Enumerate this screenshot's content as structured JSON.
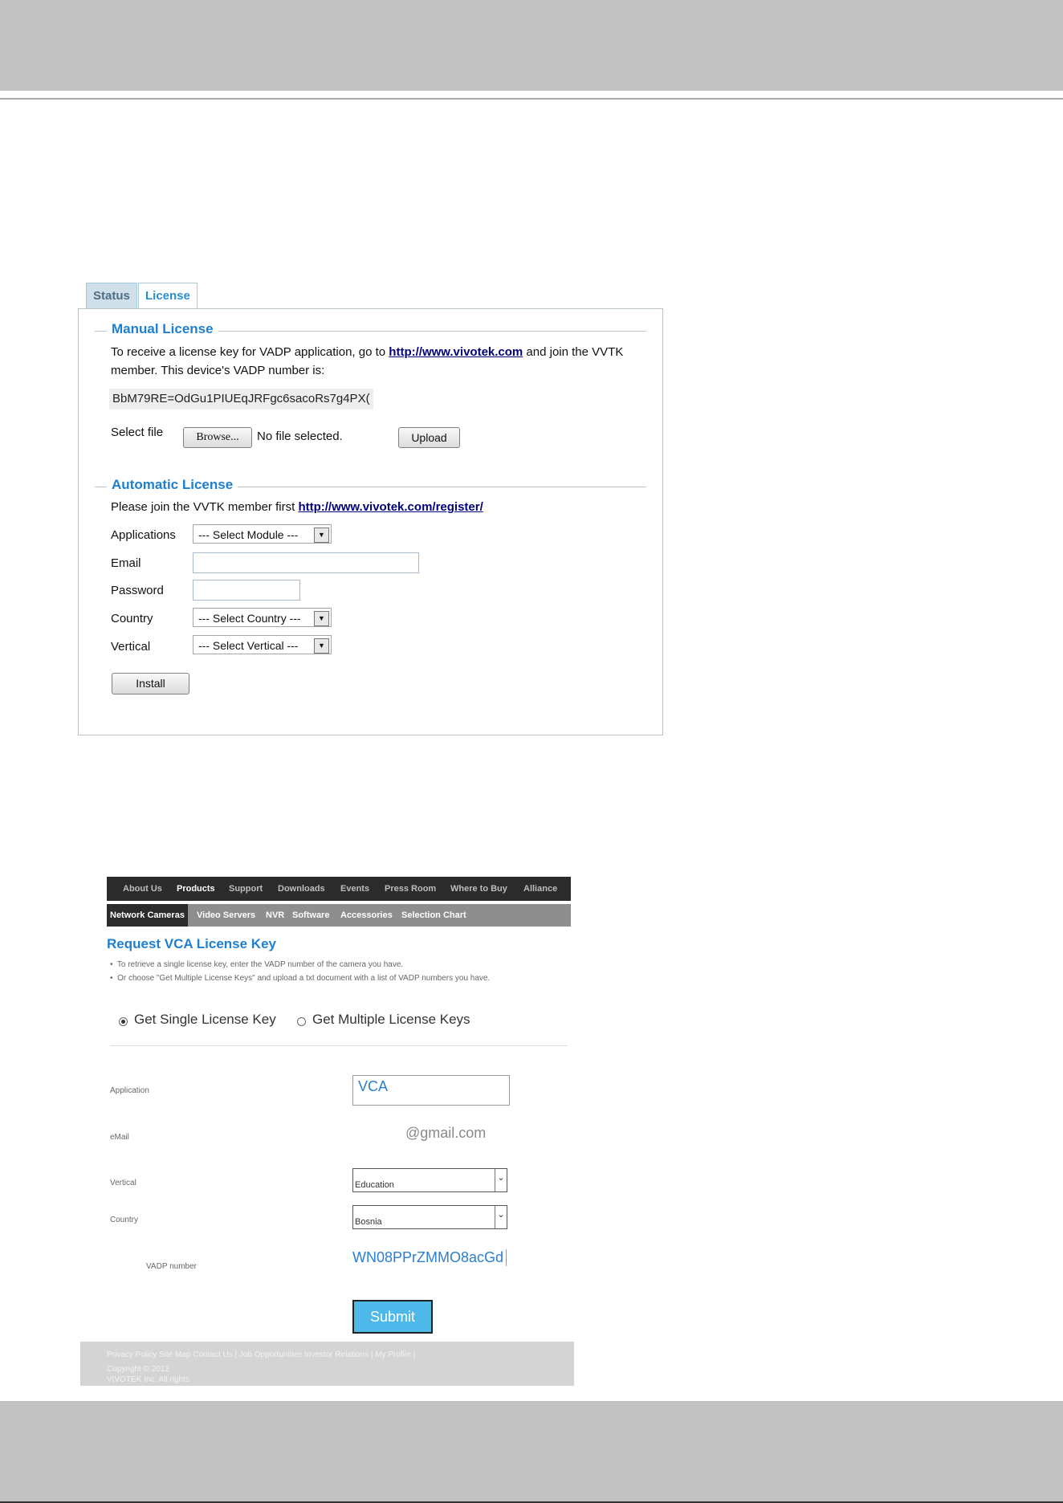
{
  "shot1": {
    "tabs": [
      "Status",
      "License"
    ],
    "manual": {
      "title": "Manual License",
      "line1_pre": "To receive a license key for VADP application, go to ",
      "line1_link": "http://www.vivotek.com",
      "line1_post": " and join the VVTK",
      "line2": "member. This device's VADP number is:",
      "vadp_number": "BbM79RE=OdGu1PIUEqJRFgc6sacoRs7g4PX(",
      "select_file_label": "Select file",
      "browse_label": "Browse...",
      "no_file_text": "No file selected.",
      "upload_label": "Upload"
    },
    "automatic": {
      "title": "Automatic License",
      "join_pre": "Please join the VVTK member first ",
      "join_link": "http://www.vivotek.com/register/",
      "applications_label": "Applications",
      "applications_value": "--- Select Module ---",
      "email_label": "Email",
      "password_label": "Password",
      "country_label": "Country",
      "country_value": "--- Select Country ---",
      "vertical_label": "Vertical",
      "vertical_value": "--- Select Vertical ---",
      "install_label": "Install"
    }
  },
  "shot2": {
    "nav_main": [
      "About Us",
      "Products",
      "Support",
      "Downloads",
      "Events",
      "Press Room",
      "Where to Buy",
      "Alliance"
    ],
    "nav_sub": [
      "Network Cameras",
      "Video Servers",
      "NVR",
      "Software",
      "Accessories",
      "Selection Chart"
    ],
    "title": "Request VCA License Key",
    "bullets": [
      "To retrieve a single license key, enter the VADP number of the camera you have.",
      "Or choose \"Get Multiple License Keys\" and upload a txt document with a list of VADP numbers you have."
    ],
    "radio_single": "Get Single License Key",
    "radio_multiple": "Get Multiple License Keys",
    "application_label": "Application",
    "application_value": "VCA",
    "email_label": "eMail",
    "email_value": "@gmail.com",
    "vertical_label": "Vertical",
    "vertical_value": "Education",
    "country_label": "Country",
    "country_value": "Bosnia",
    "vadp_label": "VADP number",
    "vadp_value": "WN08PPrZMMO8acGd",
    "submit_label": "Submit",
    "footer_links": "Privacy Policy  Site Map  Contact Us | Job Opportunities  Investor Relations | My Profile  |",
    "footer_copy1": "Copyright © 2012",
    "footer_copy2": "VIVOTEK Inc. All rights"
  }
}
